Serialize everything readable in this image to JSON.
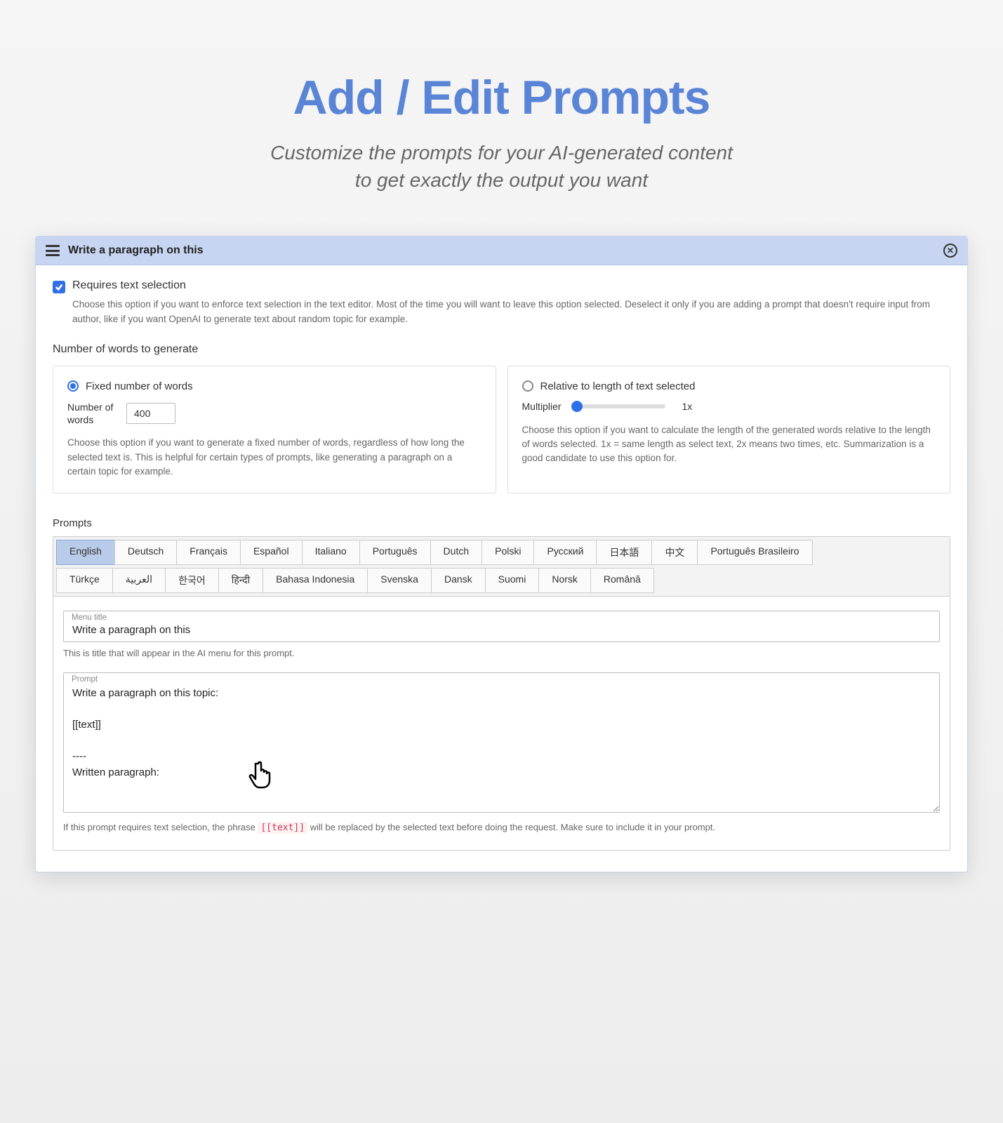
{
  "page": {
    "title": "Add / Edit Prompts",
    "subtitle_line1": "Customize the prompts for your AI-generated content",
    "subtitle_line2": "to get exactly the output you want"
  },
  "panel": {
    "title": "Write a paragraph on this"
  },
  "requires_selection": {
    "label": "Requires text selection",
    "checked": true,
    "helper": "Choose this option if you want to enforce text selection in the text editor. Most of the time you will want to leave this option selected. Deselect it only if you are adding a prompt that doesn't require input from author, like if you want OpenAI to generate text about random topic for example."
  },
  "word_count": {
    "section_label": "Number of words to generate",
    "fixed": {
      "radio_label": "Fixed number of words",
      "field_label": "Number of words",
      "value": "400",
      "helper": "Choose this option if you want to generate a fixed number of words, regardless of how long the selected text is. This is helpful for certain types of prompts, like generating a paragraph on a certain topic for example."
    },
    "relative": {
      "radio_label": "Relative to length of text selected",
      "multiplier_label": "Multiplier",
      "multiplier_value": "1x",
      "helper": "Choose this option if you want to calculate the length of the generated words relative to the length of words selected. 1x = same length as select text, 2x means two times, etc. Summarization is a good candidate to use this option for."
    }
  },
  "prompts": {
    "section_label": "Prompts",
    "tabs_row1": [
      "English",
      "Deutsch",
      "Français",
      "Español",
      "Italiano",
      "Português",
      "Dutch",
      "Polski",
      "Русский",
      "日本語",
      "中文",
      "Português Brasileiro"
    ],
    "tabs_row2": [
      "Türkçe",
      "العربية",
      "한국어",
      "हिन्दी",
      "Bahasa Indonesia",
      "Svenska",
      "Dansk",
      "Suomi",
      "Norsk",
      "Română"
    ],
    "active_tab": "English",
    "menu_title": {
      "label": "Menu title",
      "value": "Write a paragraph on this",
      "helper": "This is title that will appear in the AI menu for this prompt."
    },
    "prompt_body": {
      "label": "Prompt",
      "value": "Write a paragraph on this topic:\n\n[[text]]\n\n----\nWritten paragraph:",
      "helper_before": "If this prompt requires text selection, the phrase ",
      "helper_code": "[[text]]",
      "helper_after": " will be replaced by the selected text before doing the request. Make sure to include it in your prompt."
    }
  }
}
